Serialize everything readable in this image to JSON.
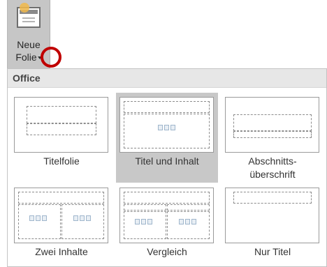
{
  "ribbon": {
    "new_slide_line1": "Neue",
    "new_slide_line2": "Folie"
  },
  "gallery": {
    "section_title": "Office",
    "layouts": [
      {
        "label": "Titelfolie",
        "selected": false
      },
      {
        "label": "Titel und Inhalt",
        "selected": true
      },
      {
        "label": "Abschnitts-",
        "label2": "überschrift",
        "selected": false
      },
      {
        "label": "Zwei Inhalte",
        "selected": false
      },
      {
        "label": "Vergleich",
        "selected": false
      },
      {
        "label": "Nur Titel",
        "selected": false
      }
    ]
  },
  "colors": {
    "highlight_ring": "#c00000",
    "selected_bg": "#c8c8c8",
    "header_bg": "#e7e7e7"
  },
  "icons": [
    "new-slide-icon",
    "dropdown-caret-icon",
    "content-placeholder-icon"
  ]
}
